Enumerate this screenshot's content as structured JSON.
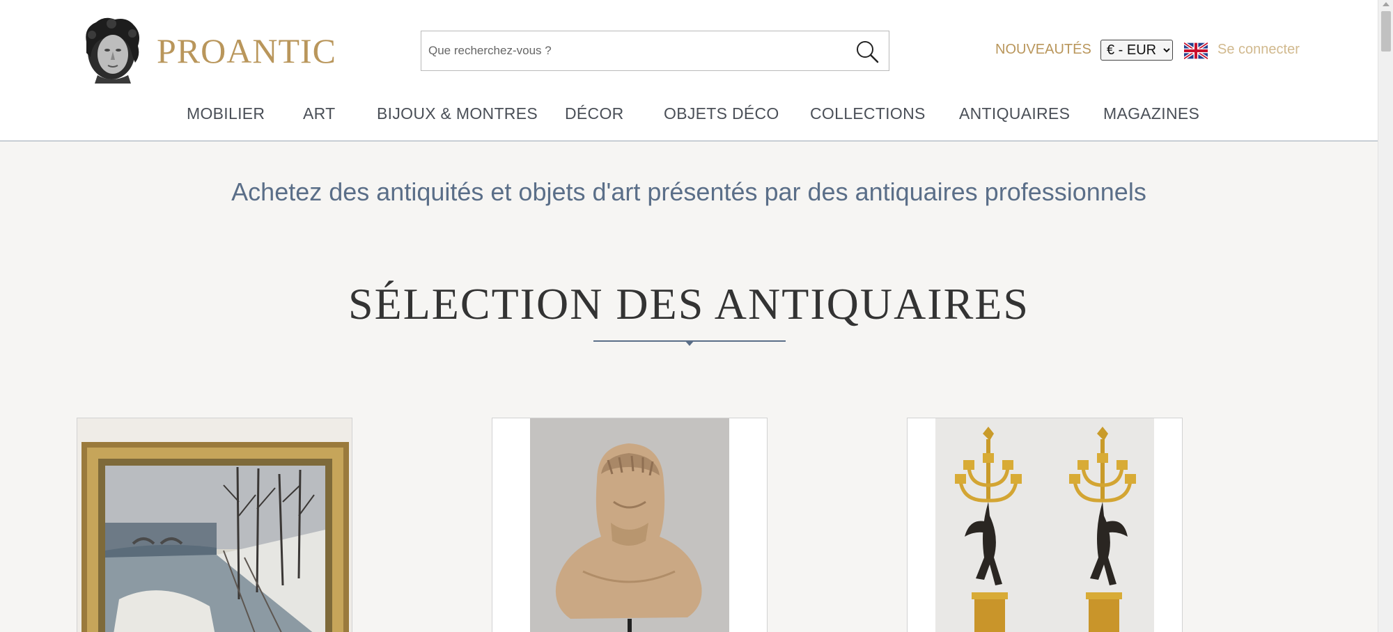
{
  "brand": {
    "name": "PROANTIC",
    "logo_icon": "bust-head-icon"
  },
  "search": {
    "placeholder": "Que recherchez-vous ?",
    "value": "",
    "icon": "search-icon"
  },
  "topbar": {
    "nouveautes": "NOUVEAUTÉS",
    "currency": {
      "selected": "€ - EUR"
    },
    "language_icon": "uk-flag-icon",
    "login": "Se connecter"
  },
  "nav": {
    "items": [
      {
        "label": "MOBILIER"
      },
      {
        "label": "ART"
      },
      {
        "label": "BIJOUX & MONTRES"
      },
      {
        "label": "DÉCOR"
      },
      {
        "label": "OBJETS DÉCO"
      },
      {
        "label": "COLLECTIONS"
      },
      {
        "label": "ANTIQUAIRES"
      },
      {
        "label": "MAGAZINES"
      }
    ]
  },
  "hero": {
    "tagline": "Achetez des antiquités et objets d'art présentés par des antiquaires professionnels",
    "section_title": "SÉLECTION DES ANTIQUAIRES"
  },
  "colors": {
    "brand_gold": "#b9965b",
    "nav_text": "#4a4f57",
    "accent_blue": "#5a6e88",
    "page_bg": "#f6f5f3"
  }
}
